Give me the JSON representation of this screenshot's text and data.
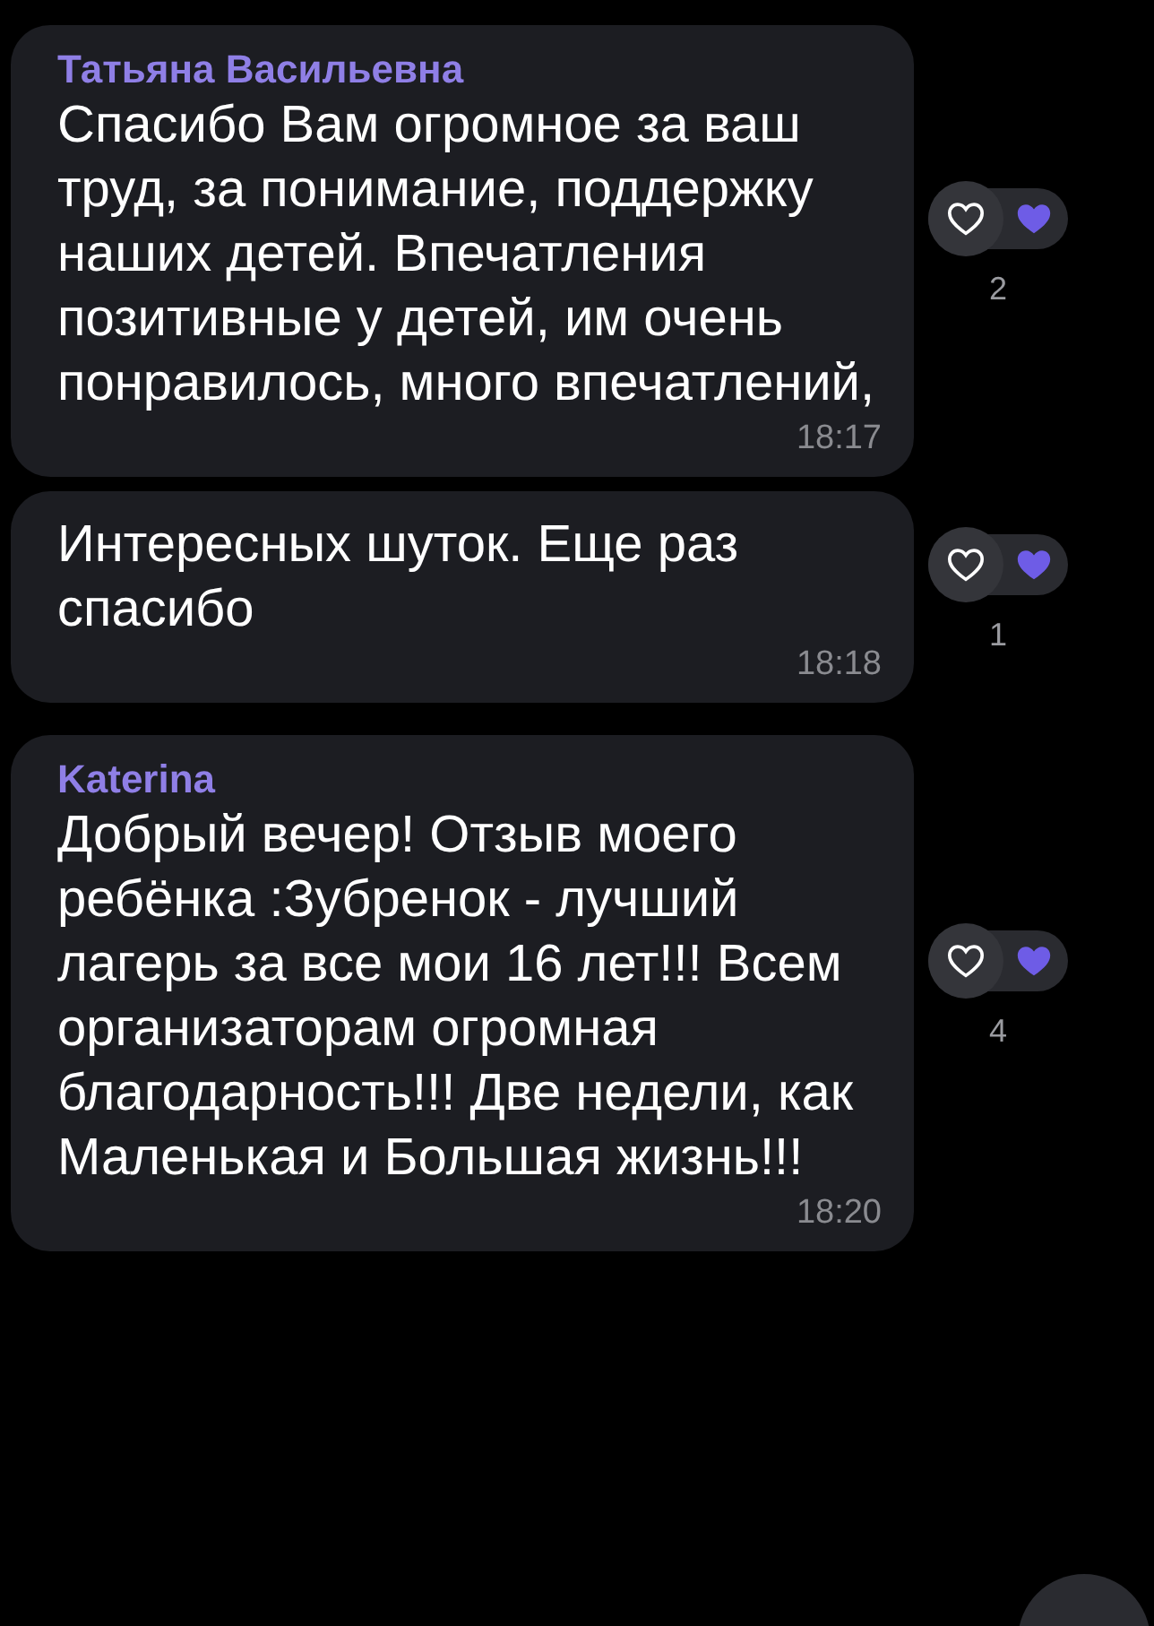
{
  "messages": [
    {
      "sender": "Татьяна Васильевна",
      "text": "Спасибо Вам огромное за ваш труд, за понимание, поддержку наших детей. Впечатления позитивные у детей, им очень понравилось, много впечатлений,",
      "time": "18:17",
      "reaction_count": "2"
    },
    {
      "text": "Интересных шуток. Еще раз спасибо",
      "time": "18:18",
      "reaction_count": "1"
    },
    {
      "sender": "Katerina",
      "text": "Добрый вечер! Отзыв моего ребёнка :Зубренок - лучший лагерь за все мои 16 лет!!! Всем организаторам огромная благодарность!!! Две недели, как Маленькая и Большая жизнь!!!",
      "time": "18:20",
      "reaction_count": "4"
    }
  ]
}
